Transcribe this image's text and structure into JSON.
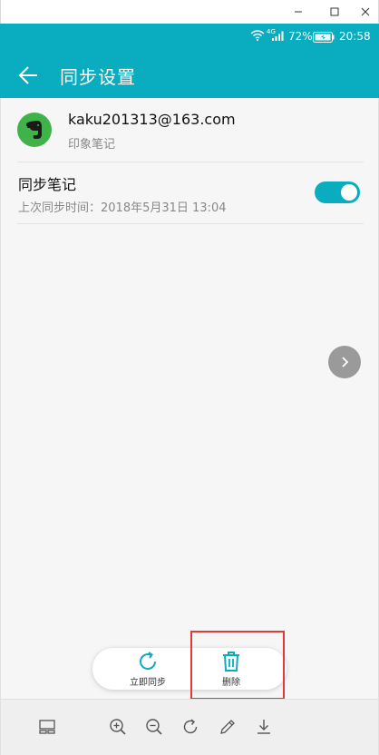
{
  "window": {
    "minimize_icon": "minimize-icon",
    "maximize_icon": "maximize-icon",
    "close_icon": "close-icon"
  },
  "status_bar": {
    "network": "4G",
    "battery_percent": "72%",
    "time": "20:58"
  },
  "header": {
    "title": "同步设置",
    "back_icon": "back-arrow-icon",
    "color": "#0aacbf"
  },
  "account": {
    "email": "kaku201313@163.com",
    "app_name": "印象笔记",
    "avatar_color": "#3fb24a"
  },
  "sync": {
    "title": "同步笔记",
    "last_sync": "上次同步时间：2018年5月31日 13:04",
    "enabled": true
  },
  "actions": [
    {
      "label": "立即同步",
      "icon": "sync-icon"
    },
    {
      "label": "删除",
      "icon": "trash-icon"
    }
  ],
  "toolbar": {
    "icons": [
      "layout-icon",
      "zoom-in-icon",
      "zoom-out-icon",
      "rotate-icon",
      "edit-icon",
      "download-icon"
    ]
  },
  "colors": {
    "accent": "#0aacbf",
    "highlight": "#e53935"
  }
}
